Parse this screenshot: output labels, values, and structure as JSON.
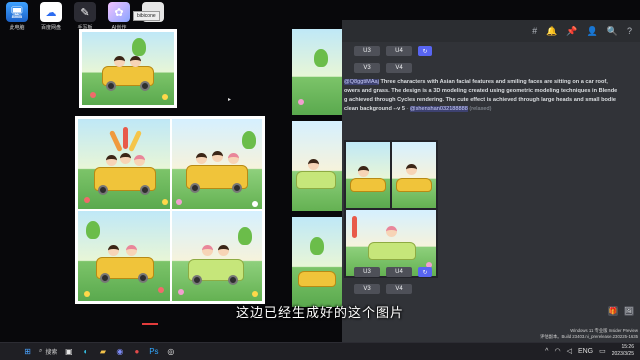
{
  "desktop": {
    "icons": [
      {
        "label": "此电脑",
        "icon": "computer-icon",
        "glyph": "🖥"
      },
      {
        "label": "百度网盘",
        "icon": "baidu-netdisk-icon",
        "glyph": "☁"
      },
      {
        "label": "手写板",
        "icon": "pen-tool-icon",
        "glyph": "✎"
      },
      {
        "label": "AI创作",
        "icon": "ai-app-icon",
        "glyph": "✿"
      },
      {
        "label": "",
        "icon": "file-icon",
        "glyph": "▭"
      }
    ],
    "file_tooltip": "bibicone"
  },
  "discord": {
    "topbar_icons": [
      "#",
      "🔔",
      "📌",
      "👤",
      "🔍",
      "?"
    ],
    "upscale_row_top": {
      "u": [
        "U3",
        "U4"
      ],
      "refresh": "↻"
    },
    "variation_row_top": [
      "V3",
      "V4"
    ],
    "message": {
      "mention_prefix": "@Q8ggtiMAaj",
      "prompt_line1": " Three characters with Asian facial features and smiling faces are sitting on a car roof,",
      "prompt_line2": "owers and grass. The design is a 3D modeling created using geometric modeling techniques in Blende",
      "prompt_line3": "g achieved through Cycles rendering. The cute effect is achieved through large heads and small bodie",
      "prompt_line4": "clean background --v 5",
      "separator": " - ",
      "user_mention": "@shenshan032188888",
      "mode": " (relaxed)"
    },
    "upscale_row_bottom": {
      "u": [
        "U3",
        "U4"
      ],
      "refresh": "↻"
    },
    "variation_row_bottom": [
      "V3",
      "V4"
    ],
    "bottom_icons": [
      "🎁",
      "🖼"
    ]
  },
  "watermark": {
    "line1": "Windows 11 专业版 Insider Preview",
    "line2": "评估副本。Build 23403.ni_prerelease.230225-1635"
  },
  "subtitle": "这边已经生成好的这个图片",
  "taskbar": {
    "search_label": "搜索",
    "lang": "ENG",
    "time": "15:26",
    "date": "2023/3/25"
  }
}
